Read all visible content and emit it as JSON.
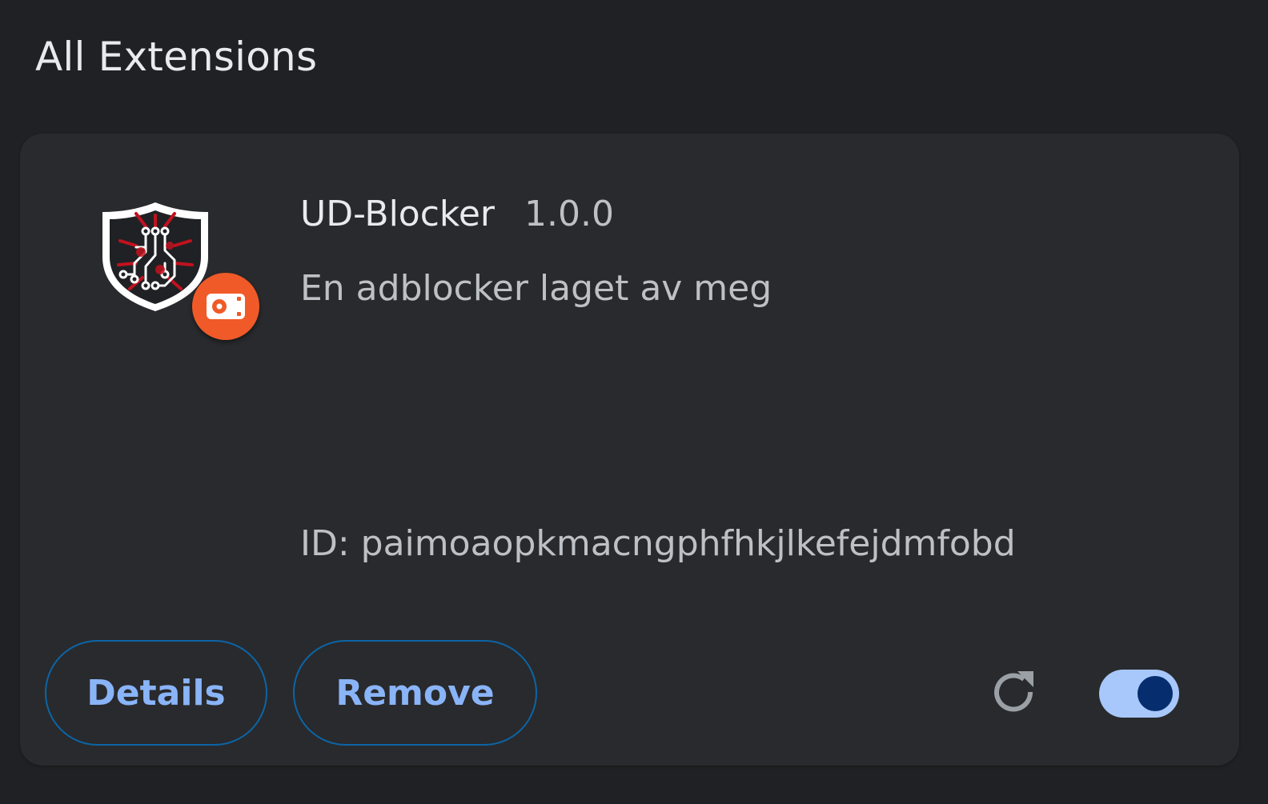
{
  "page": {
    "section_title": "All Extensions"
  },
  "extension": {
    "name": "UD-Blocker",
    "version": "1.0.0",
    "description": "En adblocker laget av meg",
    "id_text": "ID: paimoaopkmacngphfhkjlkefejdmfobd",
    "icon": "shield-circuit-icon",
    "badge_icon": "unpacked-source-icon",
    "enabled": true
  },
  "actions": {
    "details_label": "Details",
    "remove_label": "Remove",
    "reload_icon": "reload-icon"
  },
  "colors": {
    "background": "#202124",
    "card": "#292a2d",
    "accent_text": "#8ab4f8",
    "button_border": "#0b65a6",
    "toggle_track": "#a8c7fa",
    "toggle_knob": "#062e6f",
    "badge": "#f05a28",
    "shield_red": "#c1121f"
  }
}
